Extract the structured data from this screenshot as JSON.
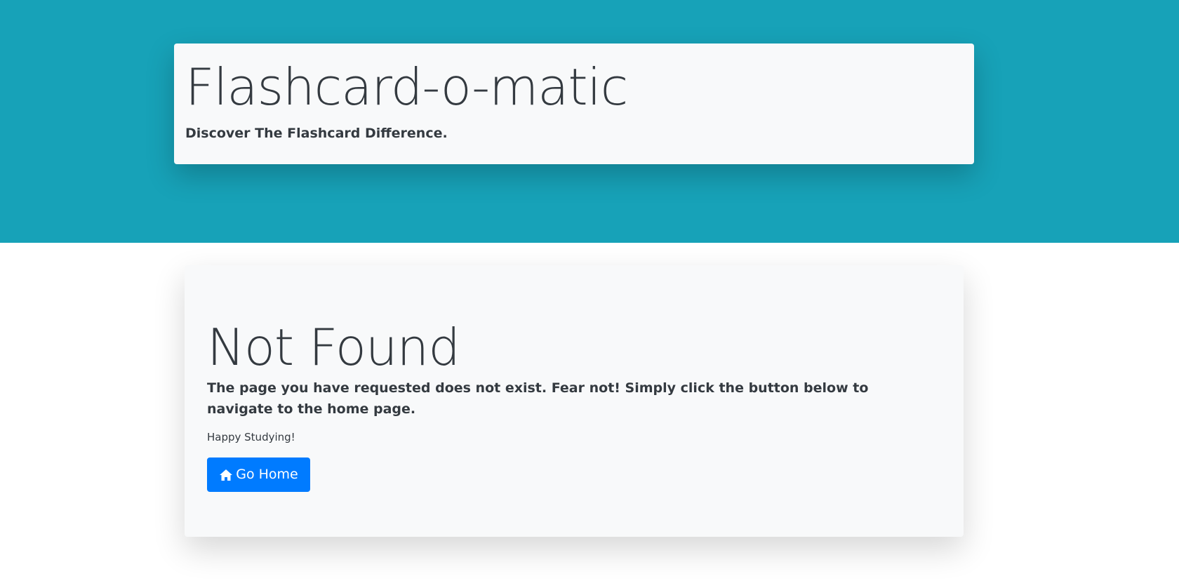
{
  "header": {
    "title": "Flashcard-o-matic",
    "tagline": "Discover The Flashcard Difference.",
    "background_color": "#17a2b8"
  },
  "not_found": {
    "title": "Not Found",
    "message": "The page you have requested does not exist. Fear not! Simply click the button below to navigate to the home page.",
    "sub_message": "Happy Studying!",
    "button": {
      "label": "Go Home",
      "icon": "home-icon",
      "color": "#007bff"
    }
  }
}
